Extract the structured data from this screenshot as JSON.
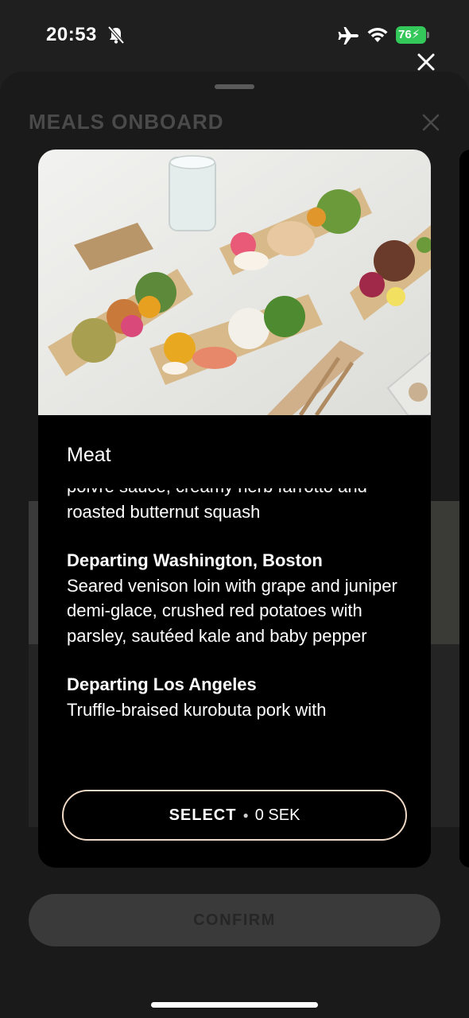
{
  "status_bar": {
    "time": "20:53",
    "battery_level": "76"
  },
  "sheet": {
    "title": "MEALS ONBOARD"
  },
  "card": {
    "category": "Meat",
    "partial_line": "poivre sauce, creamy herb farrotto and",
    "partial_line2": "roasted butternut squash",
    "sections": [
      {
        "heading": "Departing Washington, Boston",
        "text": "Seared venison loin with grape and juniper demi-glace, crushed red potatoes with parsley, sautéed kale and baby pepper"
      },
      {
        "heading": "Departing Los Angeles",
        "text": "Truffle-braised kurobuta pork with"
      }
    ],
    "select_label": "SELECT",
    "select_price": "0 SEK"
  },
  "confirm_label": "CONFIRM",
  "colors": {
    "accent_border": "#efd9c6",
    "battery_green": "#34c759"
  },
  "icons": [
    "bell-off-icon",
    "airplane-icon",
    "wifi-icon",
    "battery-icon",
    "close-icon"
  ]
}
